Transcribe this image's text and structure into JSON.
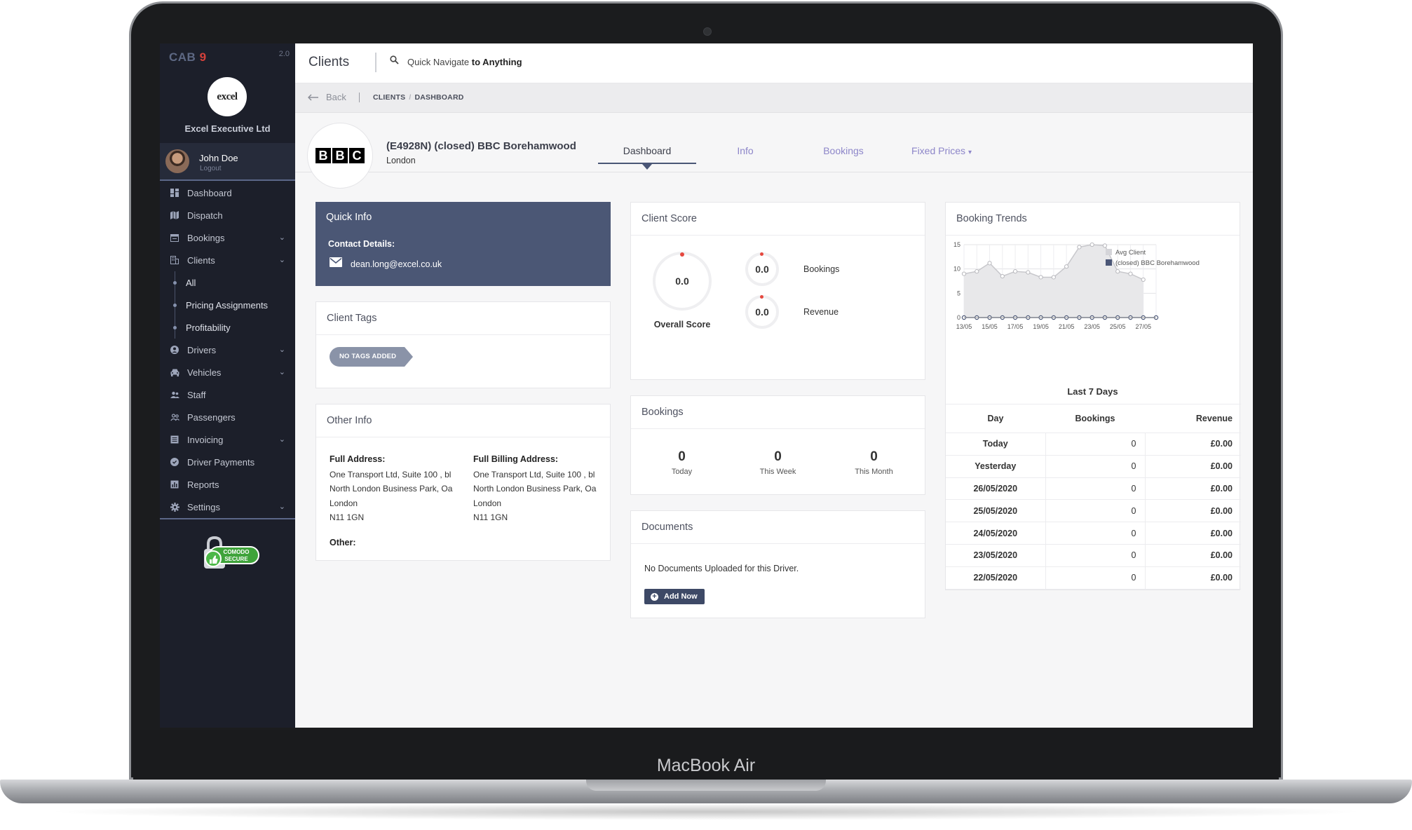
{
  "device": {
    "brand": "MacBook Air"
  },
  "app": {
    "logo_text": "CAB",
    "logo_number": "9",
    "version": "2.0"
  },
  "company": {
    "logo_text": "excel",
    "name": "Excel Executive Ltd"
  },
  "user": {
    "name": "John Doe",
    "logout": "Logout"
  },
  "sidebar": {
    "items": [
      {
        "label": "Dashboard",
        "icon": "dashboard-icon"
      },
      {
        "label": "Dispatch",
        "icon": "map-icon"
      },
      {
        "label": "Bookings",
        "icon": "calendar-icon"
      },
      {
        "label": "Clients",
        "icon": "building-icon"
      },
      {
        "label": "Drivers",
        "icon": "user-circle-icon"
      },
      {
        "label": "Vehicles",
        "icon": "car-icon"
      },
      {
        "label": "Staff",
        "icon": "staff-icon"
      },
      {
        "label": "Passengers",
        "icon": "passengers-icon"
      },
      {
        "label": "Invoicing",
        "icon": "invoice-icon"
      },
      {
        "label": "Driver Payments",
        "icon": "payment-icon"
      },
      {
        "label": "Reports",
        "icon": "reports-icon"
      },
      {
        "label": "Settings",
        "icon": "gear-icon"
      }
    ],
    "client_sub": [
      "All",
      "Pricing Assignments",
      "Profitability"
    ],
    "badge": {
      "line1": "COMODO",
      "line2": "SECURE"
    }
  },
  "topbar": {
    "title": "Clients",
    "search_prefix": "Quick Navigate",
    "search_suffix": "to Anything"
  },
  "breadcrumb": {
    "back": "Back",
    "items": [
      "CLIENTS",
      "DASHBOARD"
    ]
  },
  "client": {
    "logo_letters": [
      "B",
      "B",
      "C"
    ],
    "title": "(E4928N) (closed) BBC Borehamwood",
    "location": "London",
    "tabs": [
      "Dashboard",
      "Info",
      "Bookings",
      "Fixed Prices"
    ],
    "active_tab": "Dashboard"
  },
  "quick_info": {
    "title": "Quick Info",
    "contact_label": "Contact Details:",
    "email": "dean.long@excel.co.uk"
  },
  "client_tags": {
    "title": "Client Tags",
    "tag": "NO TAGS ADDED"
  },
  "other_info": {
    "title": "Other Info",
    "address_label": "Full Address:",
    "address_lines": [
      "One Transport Ltd, Suite 100 , bl",
      "North London Business Park, Oa",
      "London",
      "N11 1GN"
    ],
    "billing_label": "Full Billing Address:",
    "billing_lines": [
      "One Transport Ltd, Suite 100 , bl",
      "North London Business Park, Oa",
      "London",
      "N11 1GN"
    ],
    "other_label": "Other:"
  },
  "client_score": {
    "title": "Client Score",
    "overall": "0.0",
    "overall_label": "Overall Score",
    "bookings": "0.0",
    "bookings_label": "Bookings",
    "revenue": "0.0",
    "revenue_label": "Revenue"
  },
  "bookings_panel": {
    "title": "Bookings",
    "stats": [
      {
        "value": "0",
        "label": "Today"
      },
      {
        "value": "0",
        "label": "This Week"
      },
      {
        "value": "0",
        "label": "This Month"
      }
    ]
  },
  "documents": {
    "title": "Documents",
    "empty": "No Documents Uploaded for this Driver.",
    "button": "Add Now"
  },
  "booking_trends": {
    "title": "Booking Trends",
    "subtitle": "Last 7 Days",
    "table_headers": [
      "Day",
      "Bookings",
      "Revenue"
    ],
    "rows": [
      {
        "day": "Today",
        "bookings": "0",
        "revenue": "£0.00"
      },
      {
        "day": "Yesterday",
        "bookings": "0",
        "revenue": "£0.00"
      },
      {
        "day": "26/05/2020",
        "bookings": "0",
        "revenue": "£0.00"
      },
      {
        "day": "25/05/2020",
        "bookings": "0",
        "revenue": "£0.00"
      },
      {
        "day": "24/05/2020",
        "bookings": "0",
        "revenue": "£0.00"
      },
      {
        "day": "23/05/2020",
        "bookings": "0",
        "revenue": "£0.00"
      },
      {
        "day": "22/05/2020",
        "bookings": "0",
        "revenue": "£0.00"
      }
    ]
  },
  "chart_data": {
    "type": "area",
    "x": [
      "13/05",
      "14/05",
      "15/05",
      "16/05",
      "17/05",
      "18/05",
      "19/05",
      "20/05",
      "21/05",
      "22/05",
      "23/05",
      "24/05",
      "25/05",
      "26/05",
      "27/05",
      "28/05"
    ],
    "tick_labels": [
      "13/05",
      "15/05",
      "17/05",
      "19/05",
      "21/05",
      "23/05",
      "25/05",
      "27/05"
    ],
    "y_ticks": [
      0,
      5,
      10,
      15
    ],
    "ylim": [
      0,
      15
    ],
    "grid": true,
    "legend_position": "top-right",
    "series": [
      {
        "name": "Avg Client",
        "color": "#c8c8cc",
        "values": [
          9,
          9.5,
          11.2,
          8.5,
          9.5,
          9.3,
          8.3,
          8.3,
          10.5,
          14.5,
          15,
          14.8,
          9.5,
          9,
          7.8,
          null
        ]
      },
      {
        "name": "(closed) BBC Borehamwood",
        "color": "#4a5676",
        "values": [
          0,
          0,
          0,
          0,
          0,
          0,
          0,
          0,
          0,
          0,
          0,
          0,
          0,
          0,
          0,
          0
        ]
      }
    ]
  }
}
